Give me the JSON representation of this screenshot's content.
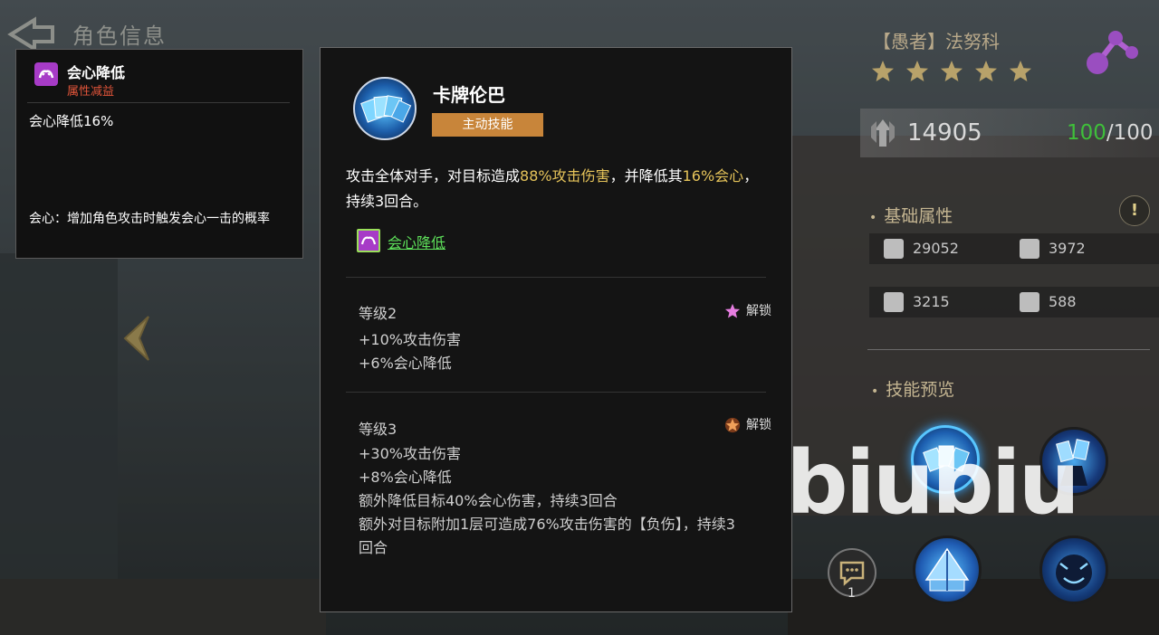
{
  "header": {
    "title": "角色信息"
  },
  "debuff_tooltip": {
    "title": "会心降低",
    "subtitle": "属性减益",
    "effect": "会心降低16%",
    "note": "会心：增加角色攻击时触发会心一击的概率"
  },
  "skill_popup": {
    "name": "卡牌伦巴",
    "type": "主动技能",
    "desc_parts": [
      "攻击全体对手，对目标造成",
      "88%攻击伤害",
      "，并降低其",
      "16%会心",
      "，持续3回合。"
    ],
    "effect_link": "会心降低",
    "levels": [
      {
        "title": "等级2",
        "unlock": "解锁",
        "lines": [
          "+10%攻击伤害",
          "+6%会心降低"
        ]
      },
      {
        "title": "等级3",
        "unlock": "解锁",
        "lines": [
          "+30%攻击伤害",
          "+8%会心降低",
          "额外降低目标40%会心伤害，持续3回合",
          "额外对目标附加1层可造成76%攻击伤害的【负伤】，持续3回合"
        ]
      }
    ]
  },
  "character": {
    "name": "【愚者】法努科",
    "stars": 5,
    "power": "14905",
    "energy_current": "100",
    "energy_max": "/100"
  },
  "base_stats": {
    "label": "基础属性",
    "hp": "29052",
    "attack": "3972",
    "defense": "3215",
    "speed": "588"
  },
  "skill_preview": {
    "label": "技能预览"
  },
  "chat": {
    "count": "1"
  },
  "watermark": "biubiu",
  "colors": {
    "highlight": "#e6c45a",
    "skill_tag": "#c8853a",
    "debuff_red": "#e2553a",
    "link_green": "#5ee05a",
    "energy_green": "#3fbf3a"
  }
}
